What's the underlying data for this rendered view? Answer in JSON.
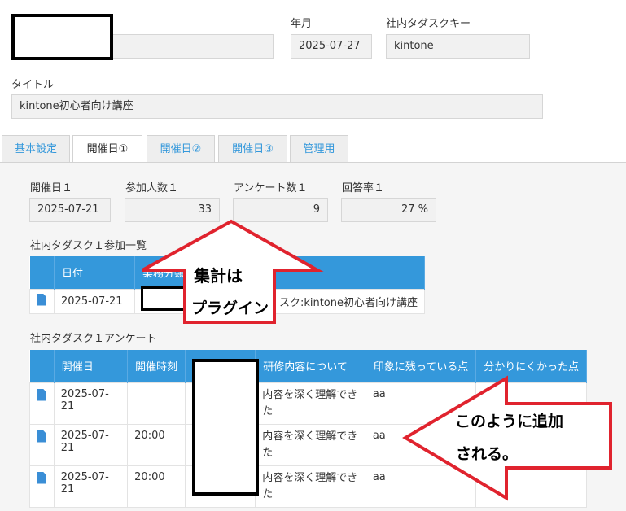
{
  "header": {
    "year_month_label": "年月",
    "year_month_value": "2025-07-27",
    "task_key_label": "社内タダスクキー",
    "task_key_value": "kintone",
    "title_label": "タイトル",
    "title_value": "kintone初心者向け講座"
  },
  "tabs": [
    {
      "label": "基本設定"
    },
    {
      "label": "開催日①"
    },
    {
      "label": "開催日②"
    },
    {
      "label": "開催日③"
    },
    {
      "label": "管理用"
    }
  ],
  "day1": {
    "date_label": "開催日１",
    "date_value": "2025-07-21",
    "participants_label": "参加人数１",
    "participants_value": "33",
    "survey_count_label": "アンケート数１",
    "survey_count_value": "9",
    "response_rate_label": "回答率１",
    "response_rate_value": "27 %"
  },
  "participants_section": {
    "title": "社内タダスク１参加一覧",
    "col_date": "日付",
    "col_business": "業務分類",
    "rows": [
      {
        "date": "2025-07-21",
        "task": "スク:kintone初心者向け講座"
      }
    ]
  },
  "survey_section": {
    "title": "社内タダスク１アンケート",
    "headers": [
      "開催日",
      "開催時刻",
      "",
      "研修内容について",
      "印象に残っている点",
      "分かりにくかった点"
    ],
    "rows": [
      {
        "date": "2025-07-21",
        "time": "",
        "content": "内容を深く理解できた",
        "impression": "aa",
        "unclear": ""
      },
      {
        "date": "2025-07-21",
        "time": "20:00",
        "content": "内容を深く理解できた",
        "impression": "aa",
        "unclear": ""
      },
      {
        "date": "2025-07-21",
        "time": "20:00",
        "content": "内容を深く理解できた",
        "impression": "aa",
        "unclear": ""
      }
    ]
  },
  "callouts": {
    "plugin_line1": "集計は",
    "plugin_line2": "プラグイン",
    "added_line1": "このように追加",
    "added_line2": "される。"
  },
  "colors": {
    "accent": "#3498db",
    "arrow": "#e0232e"
  }
}
